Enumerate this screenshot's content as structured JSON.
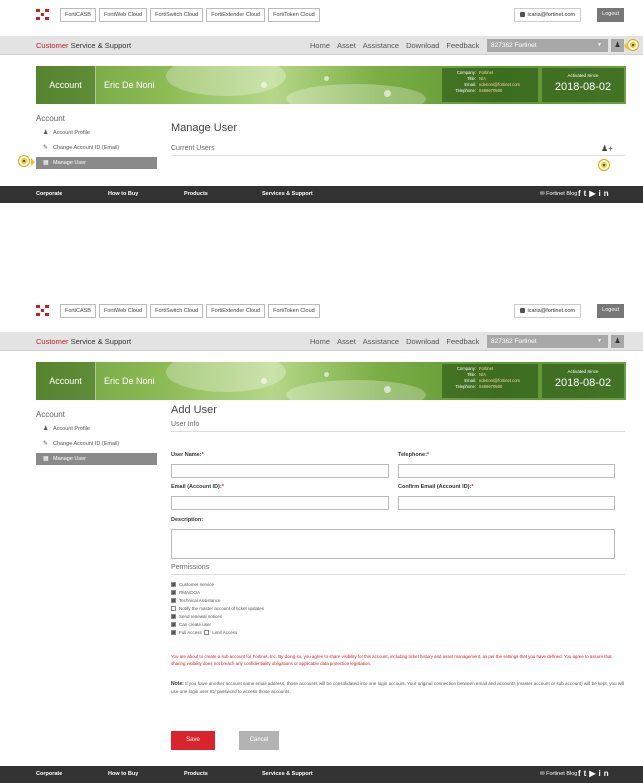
{
  "common": {
    "cloud_tabs": [
      "FortiCASB",
      "FortiWeb Cloud",
      "FortiSwitch Cloud",
      "FortiExtender Cloud",
      "FortiToken Cloud"
    ],
    "user_email": "icaria@fortinet.com",
    "logout_label": "Logout",
    "brand_accent": "Customer",
    "brand_rest": " Service & Support",
    "nav_links": [
      "Home",
      "Asset",
      "Assistance",
      "Download",
      "Feedback"
    ],
    "account_select": "827362 Fortinet",
    "banner": {
      "account_label": "Account",
      "account_name": "Eric De Noni",
      "company_key": "Company:",
      "company_val": "Fortinet",
      "title_key": "Title:",
      "title_val": "N/A",
      "email_key": "Email:",
      "email_val": "edenoni@fortinet.com",
      "phone_key": "Telephone:",
      "phone_val": "0489670580",
      "activated_label": "Activated Since",
      "activated_date": "2018-08-02"
    },
    "sidebar": {
      "title": "Account",
      "items": [
        "Account Profile",
        "Change Account ID (Email)",
        "Manage User"
      ]
    },
    "footer": {
      "links": [
        "Corporate",
        "How to Buy",
        "Products",
        "Services & Support"
      ],
      "blog": "Fortinet Blog"
    }
  },
  "screen1": {
    "heading": "Manage User",
    "section": "Current Users"
  },
  "screen2": {
    "heading": "Add User",
    "user_info": "User Info",
    "user_name_label": "User Name:",
    "telephone_label": "Telephone:",
    "email_label": "Email (Account ID):",
    "confirm_email_label": "Confirm Email (Account ID):",
    "description_label": "Description:",
    "permissions_title": "Permissions",
    "permissions": [
      {
        "label": "Customer service",
        "checked": true
      },
      {
        "label": "RMA/DOA",
        "checked": true
      },
      {
        "label": "Technical Assistance",
        "checked": true
      },
      {
        "label": "Notify the master account of ticket updates",
        "checked": false
      },
      {
        "label": "Send renewal notices",
        "checked": true
      },
      {
        "label": "Can create user",
        "checked": true
      }
    ],
    "access_full": "Full Access",
    "access_limit": "Limit Access",
    "warning": "You are about to create a sub account for Fortinet, Inc. By doing so, you agree to share visibility for this account, including ticket history and asset management, as per the settings that you have defined. You agree to assure that sharing visibility does not breach any confidentiality obligations or applicable data protection legislation.",
    "note_label": "Note:",
    "note_text": " If you have another account same email address, those accounts will be consolidated into one login account. Your original connection between email and accounts (master account or sub account) will be kept, you will use one login user ID/ password to access those accounts.",
    "save_label": "Save",
    "cancel_label": "Cancel"
  },
  "colors": {
    "accent_red": "#c8202a",
    "banner_green": "#6ea140",
    "callout_yellow": "#f3c21a",
    "footer_bg": "#333333"
  }
}
